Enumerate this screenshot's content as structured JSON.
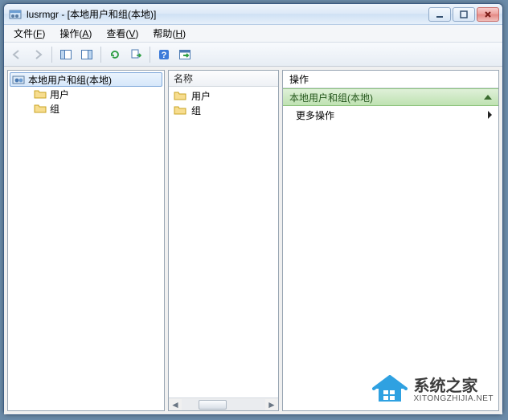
{
  "window": {
    "title": "lusrmgr - [本地用户和组(本地)]"
  },
  "menu": {
    "file": {
      "label": "文件",
      "accel": "F"
    },
    "action": {
      "label": "操作",
      "accel": "A"
    },
    "view": {
      "label": "查看",
      "accel": "V"
    },
    "help": {
      "label": "帮助",
      "accel": "H"
    }
  },
  "tree": {
    "root": {
      "label": "本地用户和组(本地)"
    },
    "children": [
      {
        "label": "用户"
      },
      {
        "label": "组"
      }
    ]
  },
  "list": {
    "header": "名称",
    "items": [
      {
        "label": "用户"
      },
      {
        "label": "组"
      }
    ]
  },
  "actions": {
    "title": "操作",
    "group": "本地用户和组(本地)",
    "items": [
      {
        "label": "更多操作"
      }
    ]
  },
  "watermark": {
    "line1": "系统之家",
    "line2": "XITONGZHIJIA.NET"
  }
}
